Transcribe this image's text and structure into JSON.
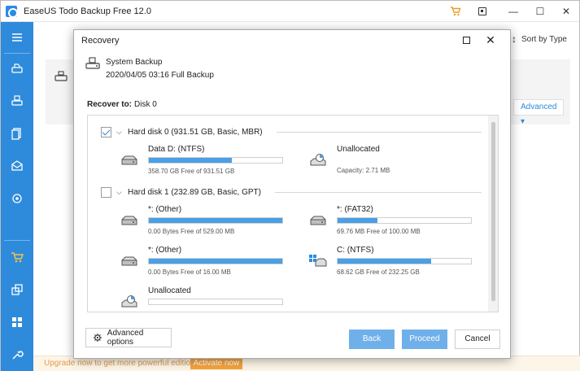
{
  "app": {
    "title": "EaseUS Todo Backup Free 12.0",
    "minimize": "—",
    "maximize": "☐",
    "close": "✕"
  },
  "background": {
    "sort_label": "Sort by Type",
    "advanced_label": "Advanced ▾",
    "upgrade_text": "Upgrade now to get more powerful edition",
    "activate_label": "Activate now"
  },
  "dialog": {
    "title": "Recovery",
    "backup_name": "System Backup",
    "backup_time": "2020/04/05 03:16 Full Backup",
    "recover_to_label": "Recover to:",
    "recover_to_value": "Disk 0",
    "disks": [
      {
        "title": "Hard disk 0 (931.51 GB, Basic, MBR)",
        "checked": true,
        "partitions": [
          {
            "name": "Data D: (NTFS)",
            "info": "358.70 GB Free of 931.51 GB",
            "used_fraction": 0.62,
            "icon": "drive-icon"
          },
          {
            "name": "Unallocated",
            "info": "Capacity: 2.71 MB",
            "used_fraction": null,
            "icon": "unallocated-icon"
          }
        ]
      },
      {
        "title": "Hard disk 1 (232.89 GB, Basic, GPT)",
        "checked": false,
        "partitions": [
          {
            "name": "*: (Other)",
            "info": "0.00 Bytes Free of 529.00 MB",
            "used_fraction": 1.0,
            "icon": "drive-icon"
          },
          {
            "name": "*: (FAT32)",
            "info": "69.76 MB Free of 100.00 MB",
            "used_fraction": 0.3,
            "icon": "drive-icon"
          },
          {
            "name": "*: (Other)",
            "info": "0.00 Bytes Free of 16.00 MB",
            "used_fraction": 1.0,
            "icon": "drive-icon"
          },
          {
            "name": "C: (NTFS)",
            "info": "68.62 GB Free of 232.25 GB",
            "used_fraction": 0.7,
            "icon": "windows-drive-icon"
          },
          {
            "name": "Unallocated",
            "info": "",
            "used_fraction": 0.0,
            "icon": "unallocated-icon"
          }
        ]
      }
    ],
    "advanced_options_label": "Advanced options",
    "back_label": "Back",
    "proceed_label": "Proceed",
    "cancel_label": "Cancel"
  },
  "colors": {
    "sidebar": "#2e8bdc",
    "primary_button": "#6fb0ea",
    "usage_bar": "#4a9fe6",
    "activate": "#f5a33c"
  }
}
